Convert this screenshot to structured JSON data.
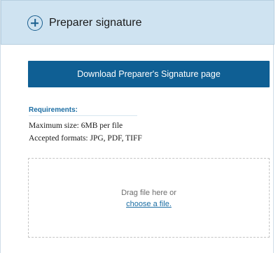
{
  "section": {
    "title": "Preparer signature",
    "expand_icon": "plus-circle-icon"
  },
  "download_button": {
    "label": "Download Preparer's Signature page"
  },
  "requirements": {
    "heading": "Requirements:",
    "max_size": "Maximum size: 6MB per file",
    "formats": "Accepted formats: JPG, PDF, TIFF"
  },
  "upload": {
    "prompt": "Drag file here or",
    "link_label": "choose a file."
  },
  "colors": {
    "header_bg": "#cfe3f1",
    "accent": "#0f5f94",
    "link": "#1b6da3"
  }
}
